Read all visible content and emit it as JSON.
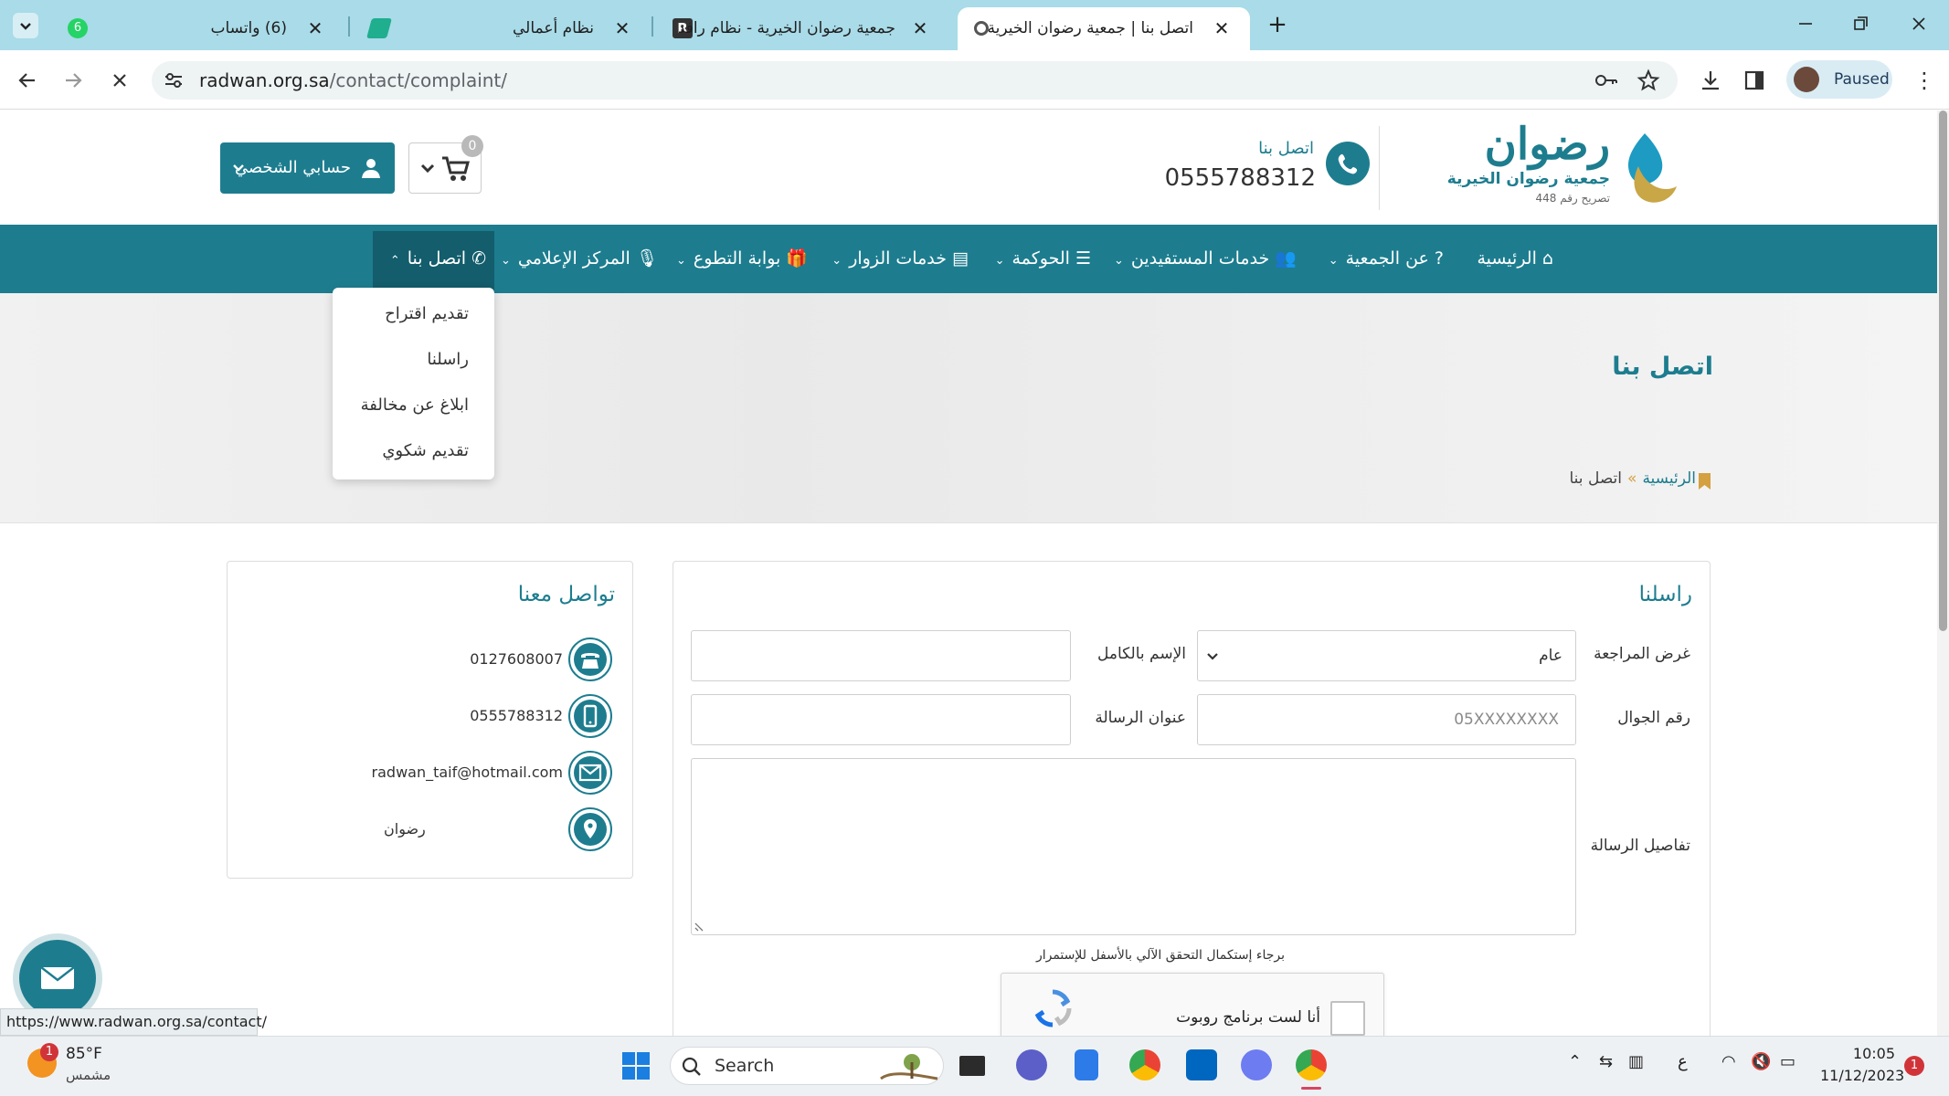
{
  "browser": {
    "tabs": [
      {
        "title": "(6) واتساب",
        "badge": "6"
      },
      {
        "title": "نظام أعمالي"
      },
      {
        "title": "جمعية رضوان الخيرية - نظام رافد"
      },
      {
        "title": "اتصل بنا | جمعية رضوان الخيرية",
        "active": true
      }
    ],
    "url_host": "radwan.org.sa",
    "url_path": "/contact/complaint/",
    "profile_status": "Paused"
  },
  "header": {
    "logo_name": "رضوان",
    "logo_subtitle": "جمعية رضوان الخيرية",
    "logo_license": "تصريح رقم 448",
    "contact_label": "اتصل بنا",
    "phone": "0555788312",
    "cart_count": "0",
    "account_label": "حسابي الشخصي"
  },
  "nav": {
    "items": [
      {
        "label": "الرئيسية",
        "icon": "home-icon"
      },
      {
        "label": "عن الجمعية",
        "icon": "question-icon"
      },
      {
        "label": "خدمات المستفيدين",
        "icon": "users-icon"
      },
      {
        "label": "الحوكمة",
        "icon": "list-icon"
      },
      {
        "label": "خدمات الزوار",
        "icon": "table-icon"
      },
      {
        "label": "بوابة التطوع",
        "icon": "gift-icon"
      },
      {
        "label": "المركز الإعلامي",
        "icon": "microphone-icon"
      },
      {
        "label": "اتصل بنا",
        "icon": "phone-icon",
        "active": true
      }
    ],
    "dropdown": [
      "تقديم اقتراح",
      "راسلنا",
      "ابلاغ عن مخالفة",
      "تقديم شكوي"
    ]
  },
  "banner": {
    "title": "اتصل بنا",
    "breadcrumb_home": "الرئيسية",
    "breadcrumb_sep": "»",
    "breadcrumb_current": "اتصل بنا"
  },
  "form": {
    "title": "راسلنا",
    "purpose_label": "غرض المراجعة",
    "purpose_value": "عام",
    "fullname_label": "الإسم بالكامل",
    "fullname_value": "",
    "mobile_label": "رقم الجوال",
    "mobile_placeholder": "05XXXXXXXX",
    "subject_label": "عنوان الرسالة",
    "subject_value": "",
    "details_label": "تفاصيل الرسالة",
    "captcha_note": "برجاء إستكمال التحقق الآلي بالأسفل للإستمرار",
    "captcha_label": "أنا لست برنامج روبوت"
  },
  "contact_info": {
    "title": "تواصل معنا",
    "items": [
      {
        "icon": "telephone-icon",
        "text": "0127608007"
      },
      {
        "icon": "mobile-icon",
        "text": "0555788312"
      },
      {
        "icon": "envelope-icon",
        "text": "radwan_taif@hotmail.com"
      },
      {
        "icon": "location-pin-icon",
        "text": "رضوان"
      }
    ]
  },
  "status_bar_url": "https://www.radwan.org.sa/contact/",
  "taskbar": {
    "weather_temp": "85°F",
    "weather_desc": "مشمس",
    "weather_badge": "1",
    "search_label": "Search",
    "lang": "ع",
    "time": "10:05",
    "date": "11/12/2023",
    "notification_count": "1"
  },
  "colors": {
    "brand": "#1d7d8f",
    "tabstrip": "#a9dbe8",
    "accent_gold": "#d4a040"
  }
}
